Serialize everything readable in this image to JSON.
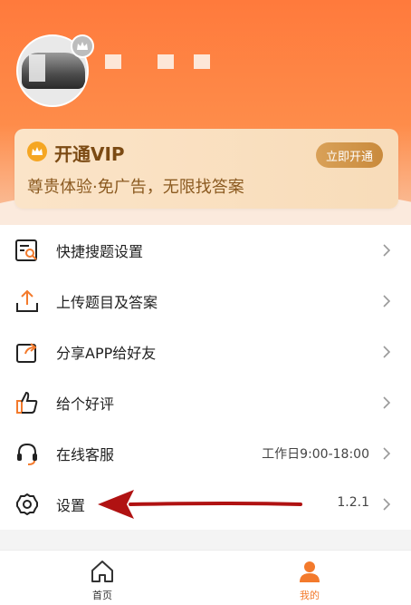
{
  "profile": {
    "username_redacted": true
  },
  "vip": {
    "title": "开通VIP",
    "subtitle": "尊贵体验·免广告，无限找答案",
    "button_label": "立即开通"
  },
  "menu": {
    "items": [
      {
        "label": "快捷搜题设置",
        "right_text": "",
        "icon": "search-settings-icon"
      },
      {
        "label": "上传题目及答案",
        "right_text": "",
        "icon": "upload-icon"
      },
      {
        "label": "分享APP给好友",
        "right_text": "",
        "icon": "share-icon"
      },
      {
        "label": "给个好评",
        "right_text": "",
        "icon": "thumbs-up-icon"
      },
      {
        "label": "在线客服",
        "right_text": "工作日9:00-18:00",
        "icon": "headset-icon"
      },
      {
        "label": "设置",
        "right_text": "1.2.1",
        "icon": "gear-icon"
      }
    ]
  },
  "tabs": [
    {
      "label": "首页",
      "active": false,
      "icon": "home-icon"
    },
    {
      "label": "我的",
      "active": true,
      "icon": "person-icon"
    }
  ],
  "colors": {
    "accent": "#ff7a3c",
    "vip_text": "#7b4a13",
    "annotation_arrow": "#b01212"
  }
}
